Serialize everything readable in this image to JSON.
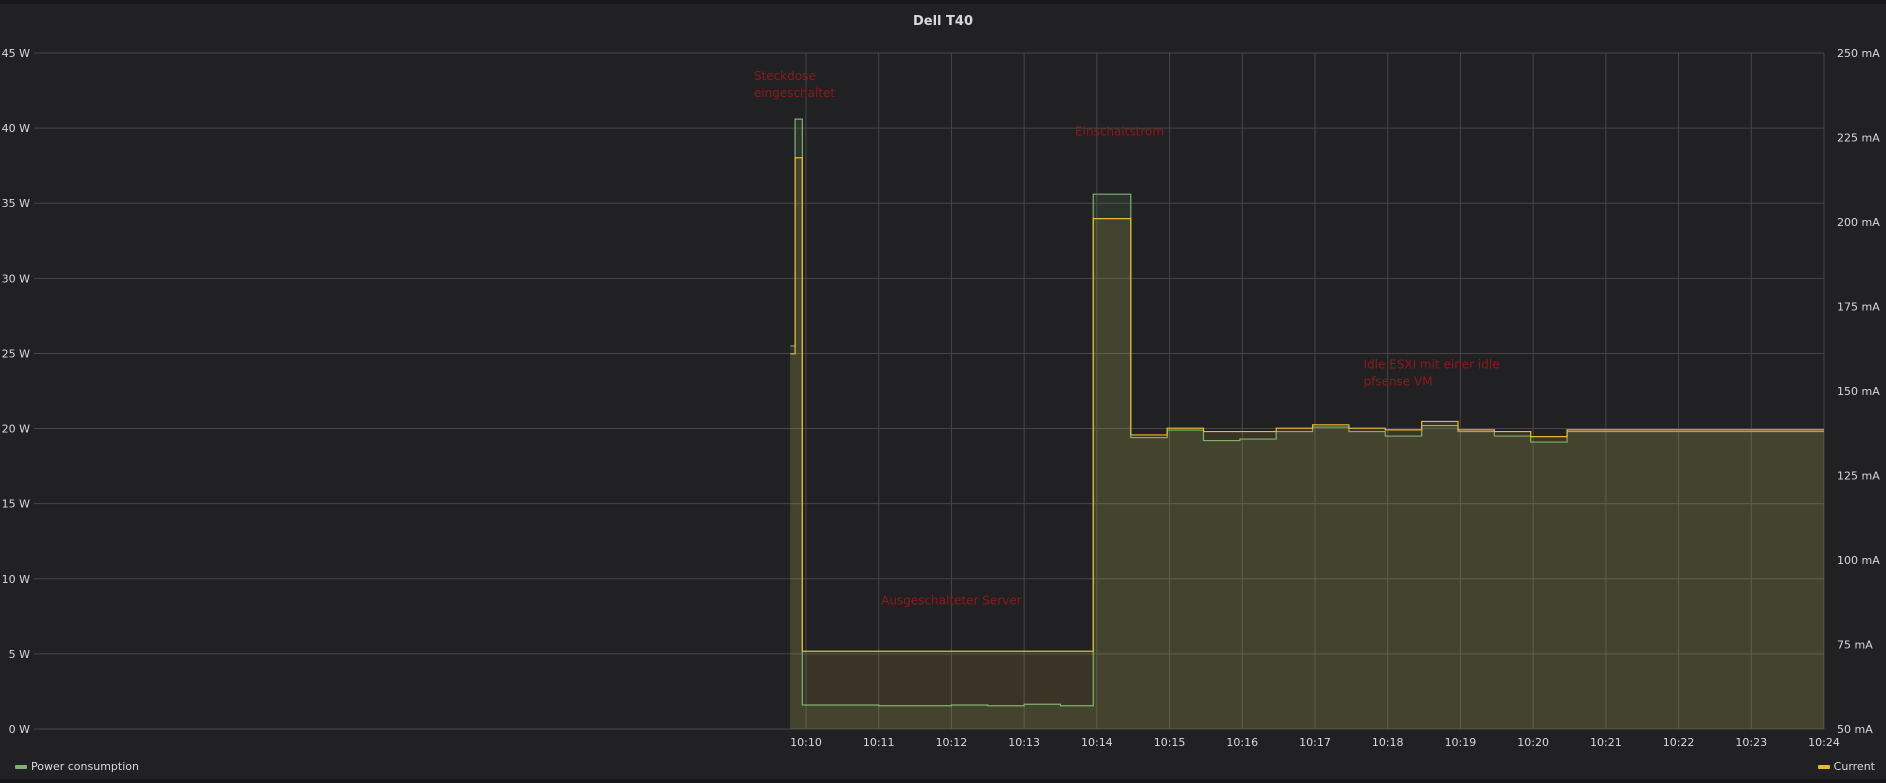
{
  "panel": {
    "title": "Dell T40"
  },
  "legend": [
    {
      "name": "Power consumption",
      "color": "#7eb26d"
    },
    {
      "name": "Current",
      "color": "#eab839"
    }
  ],
  "chart_data": {
    "type": "line",
    "title": "Dell T40",
    "y_left": {
      "unit": "W",
      "ylim": [
        0,
        45
      ],
      "ticks": [
        0,
        5,
        10,
        15,
        20,
        25,
        30,
        35,
        40,
        45
      ],
      "tick_labels": [
        "0 W",
        "5 W",
        "10 W",
        "15 W",
        "20 W",
        "25 W",
        "30 W",
        "35 W",
        "40 W",
        "45 W"
      ]
    },
    "y_right": {
      "unit": "mA",
      "ylim": [
        50,
        250
      ],
      "ticks": [
        50,
        75,
        100,
        125,
        150,
        175,
        200,
        225,
        250
      ],
      "tick_labels": [
        "50 mA",
        "75 mA",
        "100 mA",
        "125 mA",
        "150 mA",
        "175 mA",
        "200 mA",
        "225 mA",
        "250 mA"
      ]
    },
    "x_axis": {
      "xlim": [
        "09:59:23",
        "10:24:00"
      ],
      "ticks": [
        "10:10",
        "10:11",
        "10:12",
        "10:13",
        "10:14",
        "10:15",
        "10:16",
        "10:17",
        "10:18",
        "10:19",
        "10:20",
        "10:21",
        "10:22",
        "10:23",
        "10:24"
      ]
    },
    "grid": true,
    "legend_placement": "bottom",
    "series": [
      {
        "name": "Power consumption",
        "axis": "left",
        "color": "#7eb26d",
        "points": [
          [
            "10:09:47",
            25.5
          ],
          [
            "10:09:51",
            40.6
          ],
          [
            "10:09:57",
            1.6
          ],
          [
            "10:11:00",
            1.55
          ],
          [
            "10:12:00",
            1.6
          ],
          [
            "10:12:30",
            1.55
          ],
          [
            "10:13:00",
            1.65
          ],
          [
            "10:13:30",
            1.55
          ],
          [
            "10:13:57",
            35.6
          ],
          [
            "10:14:28",
            19.4
          ],
          [
            "10:14:58",
            19.9
          ],
          [
            "10:15:28",
            19.2
          ],
          [
            "10:15:58",
            19.3
          ],
          [
            "10:16:28",
            19.8
          ],
          [
            "10:16:58",
            20.1
          ],
          [
            "10:17:28",
            19.8
          ],
          [
            "10:17:58",
            19.5
          ],
          [
            "10:18:28",
            20.2
          ],
          [
            "10:18:58",
            19.8
          ],
          [
            "10:19:28",
            19.5
          ],
          [
            "10:19:58",
            19.1
          ],
          [
            "10:20:28",
            19.8
          ],
          [
            "10:24:00",
            19.8
          ]
        ]
      },
      {
        "name": "Current",
        "axis": "right",
        "color": "#eab839",
        "points": [
          [
            "10:09:47",
            161
          ],
          [
            "10:09:51",
            219
          ],
          [
            "10:09:57",
            73
          ],
          [
            "10:13:57",
            201
          ],
          [
            "10:14:28",
            137
          ],
          [
            "10:14:58",
            139
          ],
          [
            "10:15:28",
            138
          ],
          [
            "10:16:28",
            139
          ],
          [
            "10:16:58",
            140
          ],
          [
            "10:17:28",
            139
          ],
          [
            "10:17:58",
            138.5
          ],
          [
            "10:18:28",
            141
          ],
          [
            "10:18:58",
            138.5
          ],
          [
            "10:19:28",
            138
          ],
          [
            "10:19:58",
            136.5
          ],
          [
            "10:20:28",
            138.5
          ],
          [
            "10:24:00",
            138.5
          ]
        ]
      }
    ],
    "annotations": [
      {
        "text": "Steckdose eingeschaltet",
        "lines": [
          "Steckdose",
          "eingeschaltet"
        ],
        "x": "10:09:17",
        "y": 43.2
      },
      {
        "text": "Einschaltstrom",
        "lines": [
          "Einschaltstrom"
        ],
        "x": "10:13:42",
        "y": 39.5
      },
      {
        "text": "Ausgeschalteter Server",
        "lines": [
          "Ausgeschalteter Server"
        ],
        "x": "10:11:02",
        "y": 8.3
      },
      {
        "text": "Idle ESXI mit einer idle pfsense VM",
        "lines": [
          "Idle ESXI mit einer idle",
          "pfsense VM"
        ],
        "x": "10:17:40",
        "y": 24.0
      }
    ],
    "annotation_color": "#8b1a1a"
  }
}
